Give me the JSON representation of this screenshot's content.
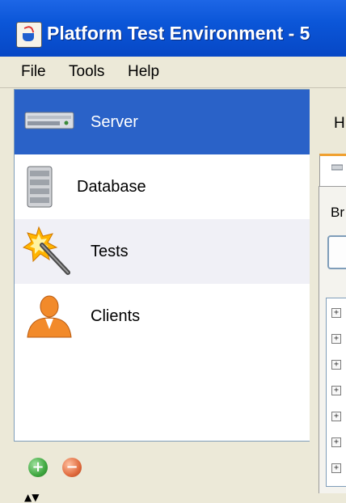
{
  "window": {
    "title": "Platform Test Environment - 5"
  },
  "menu": {
    "file": "File",
    "tools": "Tools",
    "help": "Help"
  },
  "nav": {
    "items": [
      {
        "label": "Server",
        "icon": "server-icon",
        "selected": true
      },
      {
        "label": "Database",
        "icon": "database-icon"
      },
      {
        "label": "Tests",
        "icon": "magic-wand-icon"
      },
      {
        "label": "Clients",
        "icon": "person-icon"
      }
    ]
  },
  "right": {
    "header_fragment": "H",
    "tab_fragment": "Br"
  },
  "colors": {
    "selected": "#2a62c8",
    "titlebar": "#0b56d8",
    "add": "#3fa73f",
    "remove": "#e06b3e"
  }
}
